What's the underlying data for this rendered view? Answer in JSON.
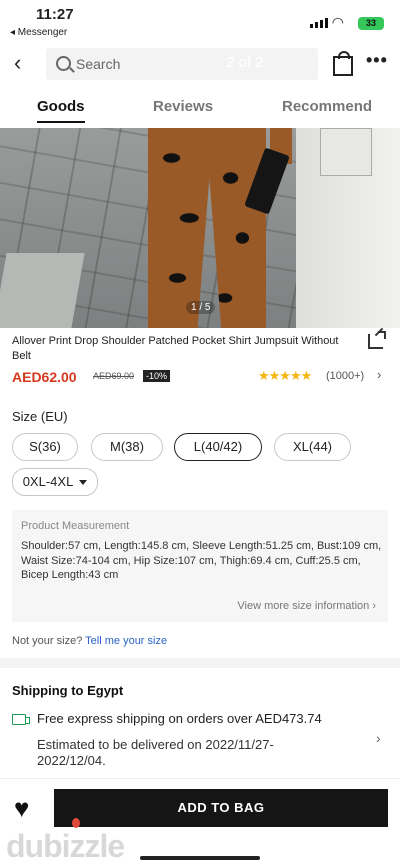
{
  "status": {
    "time": "11:27",
    "back_app": "◂ Messenger",
    "battery": "33"
  },
  "topbar": {
    "search_placeholder": "Search",
    "page_indicator": "2 of 2"
  },
  "tabs": [
    {
      "label": "Goods"
    },
    {
      "label": "Reviews"
    },
    {
      "label": "Recommend"
    }
  ],
  "gallery": {
    "pager": "1 / 5"
  },
  "product": {
    "title": "Allover Print Drop Shoulder Patched Pocket Shirt Jumpsuit Without Belt",
    "price": "AED62.00",
    "original_price": "AED69.00",
    "discount": "-10%",
    "stars": "★★★★★",
    "rating_count": "(1000+)",
    "rating_value": 4.5
  },
  "size": {
    "label": "Size (EU)",
    "options": [
      {
        "label": "S(36)"
      },
      {
        "label": "M(38)"
      },
      {
        "label": "L(40/42)",
        "selected": true
      },
      {
        "label": "XL(44)"
      }
    ],
    "dropdown": "0XL-4XL"
  },
  "measurement": {
    "title": "Product Measurement",
    "body": "Shoulder:57 cm, Length:145.8 cm, Sleeve Length:51.25 cm, Bust:109 cm, Waist Size:74-104 cm, Hip Size:107 cm, Thigh:69.4 cm, Cuff:25.5 cm, Bicep Length:43 cm",
    "more_link": "View more size information"
  },
  "not_size": {
    "text": "Not your size?",
    "link": "Tell me your size"
  },
  "shipping": {
    "title": "Shipping to Egypt",
    "free": "Free express shipping on orders over AED473.74",
    "estimate": "Estimated to be delivered on 2022/11/27-2022/12/04."
  },
  "bottom": {
    "add_to_bag": "ADD TO BAG"
  },
  "watermark": "dubizzle",
  "colors": {
    "price": "#d6391f",
    "star": "#f5b50f",
    "link": "#2b63c8",
    "shipping_icon": "#1a9a54",
    "button": "#151515"
  }
}
